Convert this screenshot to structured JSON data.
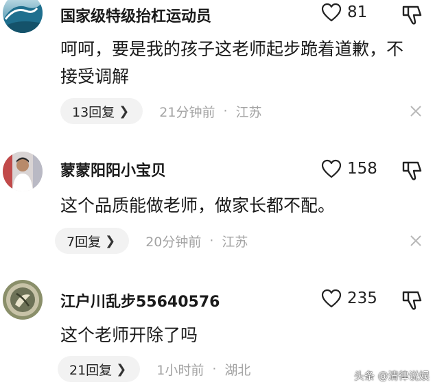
{
  "comments": [
    {
      "username": "国家级特级抬杠运动员",
      "likes": "81",
      "text": "呵呵，要是我的孩子这老师起步跪着道歉，不接受调解",
      "reply_label": "13回复",
      "time": "21分钟前",
      "separator": "·",
      "location": "江苏",
      "avatar_icon": "wave-avatar"
    },
    {
      "username": "蒙蒙阳阳小宝贝",
      "likes": "158",
      "text": "这个品质能做老师，做家长都不配。",
      "reply_label": "7回复",
      "time": "20分钟前",
      "separator": "·",
      "location": "江苏",
      "avatar_icon": "person-photo-avatar"
    },
    {
      "username": "江户川乱步55640576",
      "likes": "235",
      "text": "这个老师开除了吗",
      "reply_label": "21回复",
      "time": "1小时前",
      "separator": "·",
      "location": "湖北",
      "avatar_icon": "coin-avatar"
    }
  ],
  "icons": {
    "like": "heart-outline-icon",
    "dislike": "thumbs-down-icon",
    "close": "close-x-icon",
    "reply_chevron": "chevron-right-icon"
  },
  "watermark": "头条 @清律说娱"
}
